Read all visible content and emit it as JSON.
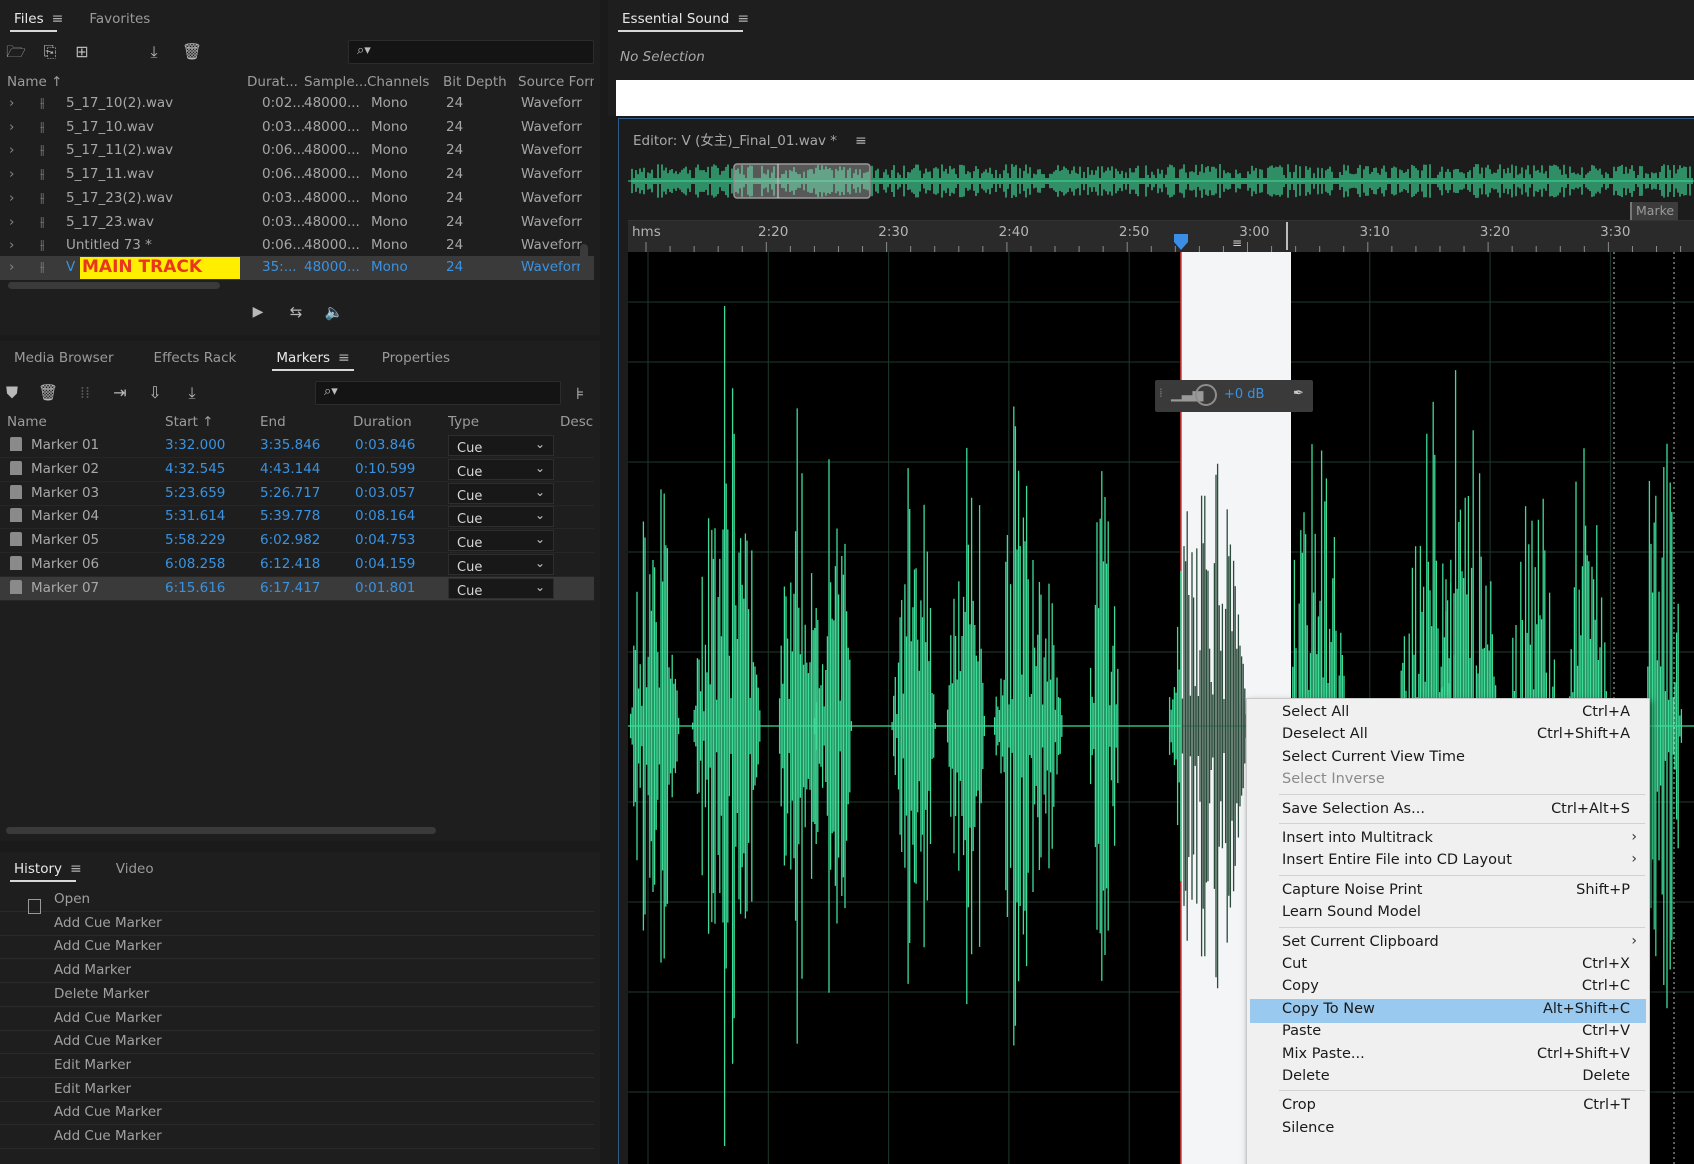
{
  "files_panel": {
    "tabs": [
      "Files",
      "Favorites"
    ],
    "search_placeholder": "",
    "columns": [
      "Name",
      "Durat...",
      "Sample...",
      "Channels",
      "Bit Depth",
      "Source Form"
    ],
    "rows": [
      {
        "name": "5_17_10(2).wav",
        "duration": "0:02...",
        "sample": "48000...",
        "channels": "Mono",
        "bit": "24",
        "format": "Waveforr"
      },
      {
        "name": "5_17_10.wav",
        "duration": "0:03...",
        "sample": "48000...",
        "channels": "Mono",
        "bit": "24",
        "format": "Waveforr"
      },
      {
        "name": "5_17_11(2).wav",
        "duration": "0:06...",
        "sample": "48000...",
        "channels": "Mono",
        "bit": "24",
        "format": "Waveforr"
      },
      {
        "name": "5_17_11.wav",
        "duration": "0:06...",
        "sample": "48000...",
        "channels": "Mono",
        "bit": "24",
        "format": "Waveforr"
      },
      {
        "name": "5_17_23(2).wav",
        "duration": "0:03...",
        "sample": "48000...",
        "channels": "Mono",
        "bit": "24",
        "format": "Waveforr"
      },
      {
        "name": "5_17_23.wav",
        "duration": "0:03...",
        "sample": "48000...",
        "channels": "Mono",
        "bit": "24",
        "format": "Waveforr"
      },
      {
        "name": "Untitled 73 *",
        "duration": "0:06...",
        "sample": "48000...",
        "channels": "Mono",
        "bit": "24",
        "format": "Waveforr"
      }
    ],
    "selected_row": {
      "name_prefix": "V",
      "label": "MAIN TRACK",
      "duration": "35:...",
      "sample": "48000...",
      "channels": "Mono",
      "bit": "24",
      "format": "Waveforr"
    }
  },
  "markers_panel": {
    "tabs": [
      "Media Browser",
      "Effects Rack",
      "Markers",
      "Properties"
    ],
    "columns": [
      "Name",
      "Start",
      "End",
      "Duration",
      "Type",
      "Desc"
    ],
    "rows": [
      {
        "name": "Marker 01",
        "start": "3:32.000",
        "end": "3:35.846",
        "duration": "0:03.846",
        "type": "Cue"
      },
      {
        "name": "Marker 02",
        "start": "4:32.545",
        "end": "4:43.144",
        "duration": "0:10.599",
        "type": "Cue"
      },
      {
        "name": "Marker 03",
        "start": "5:23.659",
        "end": "5:26.717",
        "duration": "0:03.057",
        "type": "Cue"
      },
      {
        "name": "Marker 04",
        "start": "5:31.614",
        "end": "5:39.778",
        "duration": "0:08.164",
        "type": "Cue"
      },
      {
        "name": "Marker 05",
        "start": "5:58.229",
        "end": "6:02.982",
        "duration": "0:04.753",
        "type": "Cue"
      },
      {
        "name": "Marker 06",
        "start": "6:08.258",
        "end": "6:12.418",
        "duration": "0:04.159",
        "type": "Cue"
      },
      {
        "name": "Marker 07",
        "start": "6:15.616",
        "end": "6:17.417",
        "duration": "0:01.801",
        "type": "Cue"
      }
    ]
  },
  "history_panel": {
    "tabs": [
      "History",
      "Video"
    ],
    "items": [
      "Open",
      "Add Cue Marker",
      "Add Cue Marker",
      "Add Marker",
      "Delete Marker",
      "Add Cue Marker",
      "Add Cue Marker",
      "Edit Marker",
      "Edit Marker",
      "Add Cue Marker",
      "Add Cue Marker"
    ]
  },
  "essential_sound": {
    "title": "Essential Sound",
    "status": "No Selection"
  },
  "editor": {
    "title": "Editor: V (女主)_Final_01.wav *",
    "overview_marker_label": "Marke",
    "ruler_unit": "hms",
    "ruler_ticks": [
      "2:20",
      "2:30",
      "2:40",
      "2:50",
      "3:00",
      "3:10",
      "3:20",
      "3:30"
    ],
    "hud_gain": "+0 dB",
    "waveform_color": "#3ddc97"
  },
  "context_menu": {
    "items": [
      {
        "label": "Select All",
        "shortcut": "Ctrl+A"
      },
      {
        "label": "Deselect All",
        "shortcut": "Ctrl+Shift+A"
      },
      {
        "label": "Select Current View Time",
        "shortcut": ""
      },
      {
        "label": "Select Inverse",
        "shortcut": "",
        "disabled": true
      },
      {
        "label": "Save Selection As...",
        "shortcut": "Ctrl+Alt+S"
      },
      {
        "label": "Insert into Multitrack",
        "shortcut": "",
        "submenu": true
      },
      {
        "label": "Insert Entire File into CD Layout",
        "shortcut": "",
        "submenu": true
      },
      {
        "label": "Capture Noise Print",
        "shortcut": "Shift+P"
      },
      {
        "label": "Learn Sound Model",
        "shortcut": ""
      },
      {
        "label": "Set Current Clipboard",
        "shortcut": "",
        "submenu": true
      },
      {
        "label": "Cut",
        "shortcut": "Ctrl+X"
      },
      {
        "label": "Copy",
        "shortcut": "Ctrl+C"
      },
      {
        "label": "Copy To New",
        "shortcut": "Alt+Shift+C",
        "highlighted": true
      },
      {
        "label": "Paste",
        "shortcut": "Ctrl+V"
      },
      {
        "label": "Mix Paste...",
        "shortcut": "Ctrl+Shift+V"
      },
      {
        "label": "Delete",
        "shortcut": "Delete"
      },
      {
        "label": "Crop",
        "shortcut": "Ctrl+T"
      },
      {
        "label": "Silence",
        "shortcut": ""
      }
    ]
  }
}
